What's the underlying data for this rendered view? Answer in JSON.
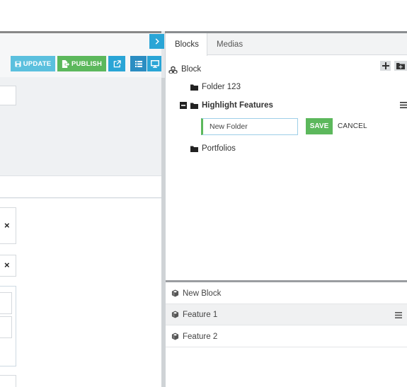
{
  "toolbar": {
    "update_label": "UPDATE",
    "publish_label": "PUBLISH"
  },
  "tabs": [
    {
      "label": "Blocks",
      "active": true
    },
    {
      "label": "Medias",
      "active": false
    }
  ],
  "tree": {
    "root_label": "Block",
    "items": [
      {
        "label": "Folder 123"
      },
      {
        "label": "Highlight Features",
        "expanded": true
      },
      {
        "label": "Portfolios"
      }
    ],
    "new_folder": {
      "value": "New Folder",
      "save_label": "SAVE",
      "cancel_label": "CANCEL"
    }
  },
  "blocks": [
    {
      "label": "New Block"
    },
    {
      "label": "Feature 1",
      "active": true
    },
    {
      "label": "Feature 2"
    }
  ],
  "colors": {
    "info": "#5bc0de",
    "success": "#5cb85c",
    "primary": "#2aa5d6"
  },
  "icons": {
    "update": "save-icon",
    "publish": "file-export-icon",
    "external": "external-link-icon",
    "list": "list-icon",
    "preview": "desktop-icon",
    "collapse": "chevron-right-icon",
    "root": "cubes-icon",
    "folder": "folder-icon",
    "block": "cube-icon",
    "menu": "hamburger-icon"
  }
}
